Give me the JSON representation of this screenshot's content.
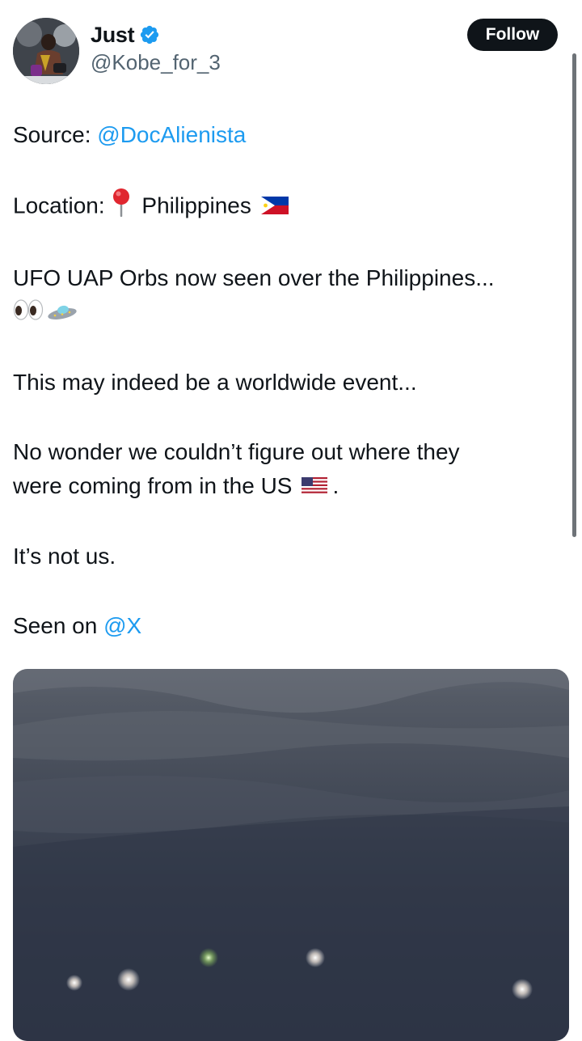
{
  "header": {
    "display_name": "Just",
    "handle": "@Kobe_for_3",
    "follow_label": "Follow",
    "verified_icon": "verified-badge-icon",
    "accent_color": "#1d9bf0"
  },
  "tweet": {
    "source_label": "Source: ",
    "source_mention": "@DocAlienista",
    "location_label": "Location: ",
    "location_icon": "round-pushpin-icon",
    "location_name": "Philippines",
    "location_flag_icon": "philippines-flag-icon",
    "line_orbs": "UFO UAP Orbs now seen over the Philippines...",
    "orbs_icons": [
      "eyes-icon",
      "flying-saucer-icon"
    ],
    "line_worldwide": "This may indeed be a worldwide event...",
    "line_wonder_1": "No wonder we couldn’t figure out where they",
    "line_wonder_2": "were coming from in the US",
    "us_flag_icon": "us-flag-icon",
    "line_wonder_end": ".",
    "line_not_us": "It’s not us.",
    "seen_on_label": "Seen on ",
    "seen_on_mention": "@X"
  },
  "media": {
    "type": "video-still",
    "icon": "night-sky-orbs-image"
  }
}
